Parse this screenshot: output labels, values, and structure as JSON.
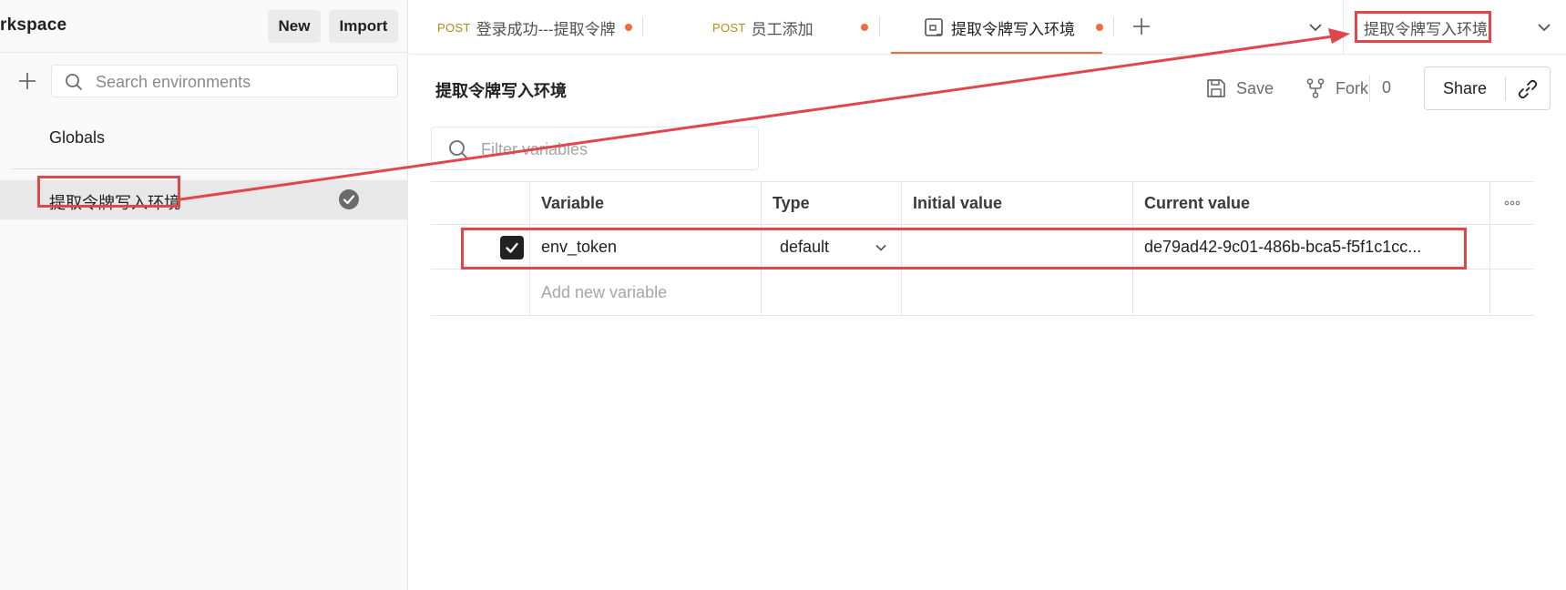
{
  "sidebar": {
    "workspace_name": "rkspace",
    "new_label": "New",
    "import_label": "Import",
    "search_placeholder": "Search environments",
    "globals_label": "Globals",
    "environments": [
      {
        "label": "提取令牌写入环境",
        "active": true
      }
    ]
  },
  "tabs": [
    {
      "method": "POST",
      "label": "登录成功---提取令牌",
      "unsaved": true
    },
    {
      "method": "POST",
      "label": "员工添加",
      "unsaved": true
    },
    {
      "method": "",
      "label": "提取令牌写入环境",
      "unsaved": true,
      "active": true,
      "icon": "environment-icon"
    }
  ],
  "env_selector": {
    "value": "提取令牌写入环境"
  },
  "main": {
    "title": "提取令牌写入环境",
    "save_label": "Save",
    "fork_label": "Fork",
    "fork_count": "0",
    "share_label": "Share",
    "filter_placeholder": "Filter variables",
    "columns": [
      "Variable",
      "Type",
      "Initial value",
      "Current value"
    ],
    "variables": [
      {
        "enabled": true,
        "name": "env_token",
        "type": "default",
        "initial": "",
        "current": "de79ad42-9c01-486b-bca5-f5f1c1cc..."
      }
    ],
    "add_placeholder": "Add new variable"
  },
  "colors": {
    "accent": "#f26b3a",
    "annotation_red": "#e0474c",
    "method_post": "#b58a1e"
  }
}
